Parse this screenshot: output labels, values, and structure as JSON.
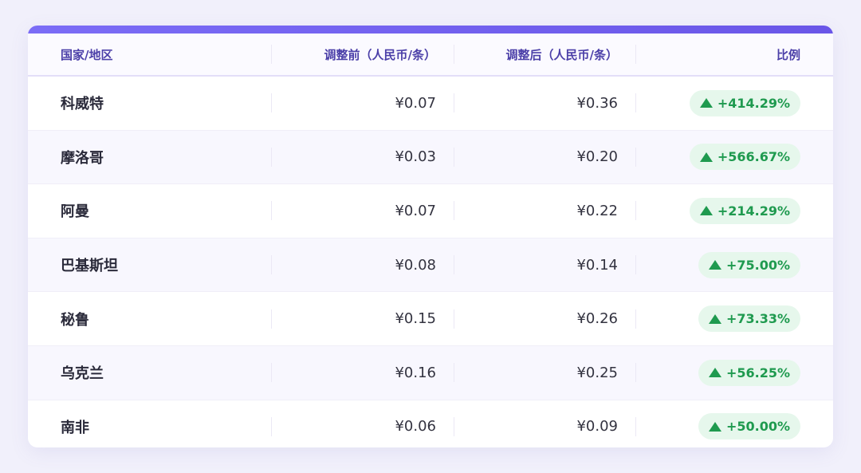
{
  "table": {
    "headers": {
      "country": "国家/地区",
      "before": "调整前（人民币/条）",
      "after": "调整后（人民币/条）",
      "ratio": "比例"
    },
    "rows": [
      {
        "country": "科威特",
        "before": "¥0.07",
        "after": "¥0.36",
        "ratio": "+414.29%"
      },
      {
        "country": "摩洛哥",
        "before": "¥0.03",
        "after": "¥0.20",
        "ratio": "+566.67%"
      },
      {
        "country": "阿曼",
        "before": "¥0.07",
        "after": "¥0.22",
        "ratio": "+214.29%"
      },
      {
        "country": "巴基斯坦",
        "before": "¥0.08",
        "after": "¥0.14",
        "ratio": "+75.00%"
      },
      {
        "country": "秘鲁",
        "before": "¥0.15",
        "after": "¥0.26",
        "ratio": "+73.33%"
      },
      {
        "country": "乌克兰",
        "before": "¥0.16",
        "after": "¥0.25",
        "ratio": "+56.25%"
      },
      {
        "country": "南非",
        "before": "¥0.06",
        "after": "¥0.09",
        "ratio": "+50.00%"
      }
    ]
  },
  "colors": {
    "accent": "#6a56e8",
    "header_text": "#4b3fa8",
    "increase": "#1f9a4f",
    "increase_bg": "#e6f7ec"
  },
  "icons": {
    "increase": "triangle-up-icon"
  }
}
